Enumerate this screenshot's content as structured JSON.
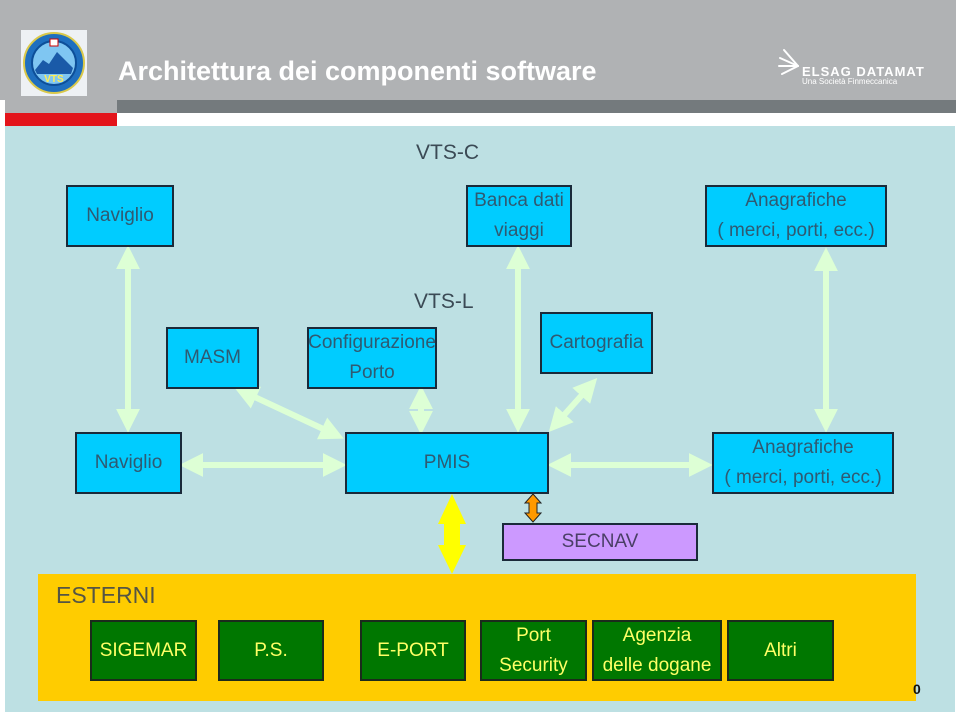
{
  "header": {
    "title": "Architettura dei componenti software",
    "logo_text": "VTS",
    "brand_name": "ELSAG DATAMAT",
    "brand_subtitle": "Una Società Finmeccanica"
  },
  "groups": {
    "vts_c": "VTS-C",
    "vts_l": "VTS-L"
  },
  "vts_c_boxes": {
    "naviglio": [
      "Naviglio"
    ],
    "banca_dati": [
      "Banca dati",
      "viaggi"
    ],
    "anagrafiche": [
      "Anagrafiche",
      "( merci, porti, ecc.)"
    ]
  },
  "vts_l_boxes": {
    "masm": [
      "MASM"
    ],
    "configurazione": [
      "Configurazione",
      "Porto"
    ],
    "cartografia": [
      "Cartografia"
    ],
    "naviglio": [
      "Naviglio"
    ],
    "pmis": [
      "PMIS"
    ],
    "anagrafiche": [
      "Anagrafiche",
      "( merci, porti, ecc.)"
    ],
    "secnav": [
      "SECNAV"
    ]
  },
  "esterni": {
    "label": "ESTERNI",
    "items": [
      [
        "SIGEMAR"
      ],
      [
        "P.S."
      ],
      [
        "E-PORT"
      ],
      [
        "Port",
        "Security"
      ],
      [
        "Agenzia",
        "delle dogane"
      ],
      [
        "Altri"
      ]
    ]
  },
  "page_number": "0",
  "colors": {
    "component_box": "#00ccff",
    "secnav_box": "#cc99ff",
    "external_box": "#007700",
    "external_text": "#ffff66",
    "external_panel": "#ffcc00",
    "canvas": "#bde0e3",
    "arrow_default": "#ddffd5",
    "arrow_external": "#ffff00",
    "arrow_secnav": "#ff9900",
    "accent_red": "#e3141b"
  }
}
